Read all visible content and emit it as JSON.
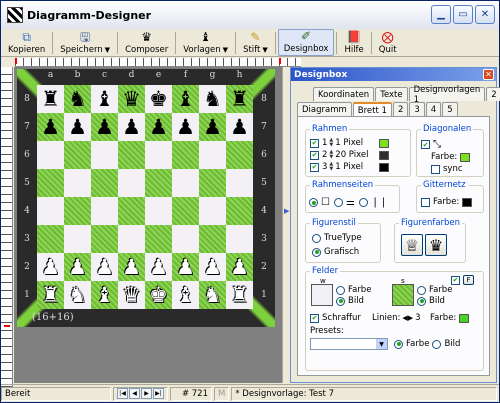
{
  "window": {
    "title": "Diagramm-Designer"
  },
  "toolbar": {
    "kopieren": "Kopieren",
    "speichern": "Speichern",
    "composer": "Composer",
    "vorlagen": "Vorlagen",
    "stift": "Stift",
    "designbox": "Designbox",
    "hilfe": "Hilfe",
    "quit": "Quit"
  },
  "board": {
    "files": [
      "a",
      "b",
      "c",
      "d",
      "e",
      "f",
      "g",
      "h"
    ],
    "ranks": [
      "8",
      "7",
      "6",
      "5",
      "4",
      "3",
      "2",
      "1"
    ],
    "caption": "(16+16)",
    "position": [
      [
        "br",
        "bn",
        "bb",
        "bq",
        "bk",
        "bb",
        "bn",
        "br"
      ],
      [
        "bp",
        "bp",
        "bp",
        "bp",
        "bp",
        "bp",
        "bp",
        "bp"
      ],
      [
        "",
        "",
        "",
        "",
        "",
        "",
        "",
        ""
      ],
      [
        "",
        "",
        "",
        "",
        "",
        "",
        "",
        ""
      ],
      [
        "",
        "",
        "",
        "",
        "",
        "",
        "",
        ""
      ],
      [
        "",
        "",
        "",
        "",
        "",
        "",
        "",
        ""
      ],
      [
        "wp",
        "wp",
        "wp",
        "wp",
        "wp",
        "wp",
        "wp",
        "wp"
      ],
      [
        "wr",
        "wn",
        "wb",
        "wq",
        "wk",
        "wb",
        "wn",
        "wr"
      ]
    ]
  },
  "designbox": {
    "title": "Designbox",
    "tabs_row1": [
      "Koordinaten",
      "Texte",
      "Designvorlagen 1",
      "2"
    ],
    "tabs_row2": [
      "Diagramm",
      "Brett 1",
      "2",
      "3",
      "4",
      "5"
    ],
    "rahmen": {
      "label": "Rahmen",
      "rows": [
        {
          "value": "1",
          "unit": "1 Pixel",
          "color": "#7be01d"
        },
        {
          "value": "2",
          "unit": "20 Pixel",
          "color": "#2e2e2e"
        },
        {
          "value": "3",
          "unit": "1 Pixel",
          "color": "#000000"
        }
      ]
    },
    "diagonalen": {
      "label": "Diagonalen",
      "farbe": "Farbe:",
      "farbe_color": "#7be01d",
      "sync": "sync"
    },
    "rahmenseiten": {
      "label": "Rahmenseiten"
    },
    "gitternetz": {
      "label": "Gitternetz",
      "farbe": "Farbe:",
      "farbe_color": "#000000"
    },
    "figurenstil": {
      "label": "Figurenstil",
      "opt1": "TrueType",
      "opt2": "Grafisch"
    },
    "figurenfarben": {
      "label": "Figurenfarben"
    },
    "felder": {
      "label": "Felder",
      "w": "w",
      "s": "s",
      "farbe": "Farbe",
      "bild": "Bild",
      "schraffur": "Schraffur",
      "linien": "Linien:",
      "linien_value": "3",
      "farbe2": "Farbe:",
      "farbe_color": "#49d42b",
      "f_btn": "F",
      "presets": "Presets:",
      "preset_farbe": "Farbe",
      "preset_bild": "Bild"
    }
  },
  "status": {
    "ready": "Bereit",
    "number": "# 721",
    "m": "M",
    "vorlage": "* Designvorlage: Test 7"
  }
}
